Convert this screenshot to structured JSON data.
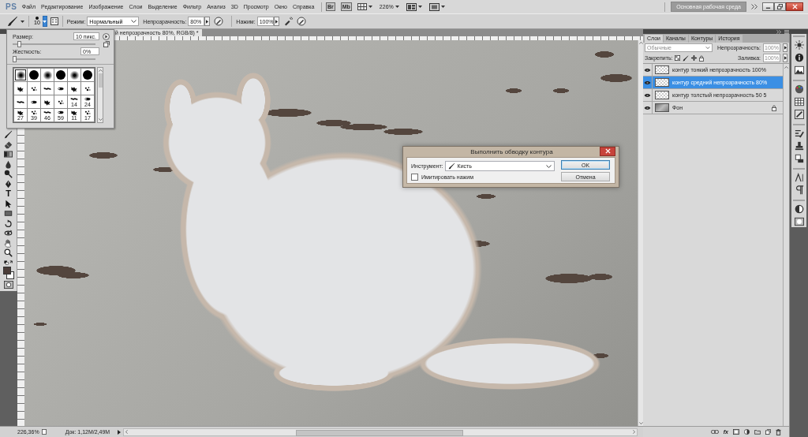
{
  "app": {
    "logo": "PS",
    "menu": [
      "Файл",
      "Редактирование",
      "Изображение",
      "Слои",
      "Выделение",
      "Фильтр",
      "Анализ",
      "3D",
      "Просмотр",
      "Окно",
      "Справка"
    ],
    "launchers": [
      "Br",
      "Mb"
    ],
    "zoom": "226%",
    "workspace": "Основная рабочая среда"
  },
  "options_bar": {
    "brush_size": "10",
    "mode_label": "Режим:",
    "mode": "Нормальный",
    "opacity_label": "Непрозрачность:",
    "opacity": "80%",
    "pressure_label": "Нажим:",
    "pressure": "100%"
  },
  "document": {
    "tab": "й непрозрачность 80%, RGB/8) *"
  },
  "toolbar": {
    "tools": [
      {
        "kind": "brush"
      },
      {
        "kind": "eraser"
      },
      {
        "kind": "gradient"
      },
      {
        "kind": "blur"
      },
      {
        "kind": "dodge"
      },
      {
        "kind": "pen"
      },
      {
        "kind": "type",
        "glyph": "T"
      },
      {
        "kind": "path-select"
      },
      {
        "kind": "shape"
      },
      {
        "kind": "rotate-3d"
      },
      {
        "kind": "orbit-3d"
      },
      {
        "kind": "hand"
      },
      {
        "kind": "zoom"
      }
    ],
    "colors": [
      {
        "kind": "background",
        "color": "#ffffff"
      },
      {
        "kind": "foreground",
        "color": "#4b3d39"
      }
    ]
  },
  "brush_panel": {
    "size_label": "Размер:",
    "size": "10 пикс.",
    "size_slider": {
      "level": 0.06
    },
    "hardness_label": "Жесткость:",
    "hardness": "0%",
    "hardness_slider": {
      "level": 0
    },
    "brushes": [
      {
        "kind": "soft",
        "selected": true
      },
      {
        "kind": "hard",
        "selected": false
      },
      {
        "kind": "soft",
        "selected": false
      },
      {
        "kind": "hard",
        "selected": false
      },
      {
        "kind": "soft",
        "selected": false
      },
      {
        "kind": "hard",
        "selected": false
      },
      {
        "kind": "special",
        "selected": false
      },
      {
        "kind": "special",
        "selected": false
      },
      {
        "kind": "special",
        "selected": false
      },
      {
        "kind": "special",
        "selected": false
      },
      {
        "kind": "special",
        "selected": false
      },
      {
        "kind": "special",
        "selected": false
      },
      {
        "kind": "special",
        "selected": false
      },
      {
        "kind": "special",
        "selected": false
      },
      {
        "kind": "special",
        "selected": false
      },
      {
        "kind": "special",
        "selected": false
      },
      {
        "kind": "special",
        "size": "14",
        "selected": false
      },
      {
        "kind": "special",
        "size": "24",
        "selected": false
      },
      {
        "kind": "special",
        "size": "27",
        "selected": false
      },
      {
        "kind": "special",
        "size": "39",
        "selected": false
      },
      {
        "kind": "special",
        "size": "46",
        "selected": false
      },
      {
        "kind": "special",
        "size": "59",
        "selected": false
      },
      {
        "kind": "special",
        "size": "11",
        "selected": false
      },
      {
        "kind": "special",
        "size": "17",
        "selected": false
      }
    ]
  },
  "dialog": {
    "title": "Выполнить обводку контура",
    "tool_label": "Инструмент:",
    "tool": "Кисть",
    "simulate_pressure": {
      "label": "Имитировать нажим",
      "checked": false
    },
    "buttons": [
      {
        "label": "OK",
        "default": true
      },
      {
        "label": "Отмена",
        "default": false
      }
    ]
  },
  "layers_panel": {
    "tabs": [
      {
        "label": "Слои",
        "selected": true
      },
      {
        "label": "Каналы",
        "selected": false
      },
      {
        "label": "Контуры",
        "selected": false
      },
      {
        "label": "История",
        "selected": false
      }
    ],
    "blend_mode": {
      "value": "Обычные",
      "disabled": true
    },
    "opacity_label": "Непрозрачность:",
    "opacity": {
      "value": "100%",
      "disabled": true
    },
    "lock_label": "Закрепить:",
    "fill_label": "Заливка:",
    "fill": {
      "value": "100%",
      "disabled": true
    },
    "layers": [
      {
        "name": "контур тонкий непрозрачность 100%",
        "kind": "transparent",
        "visible": true,
        "locked": false,
        "selected": false
      },
      {
        "name": "контур средний непрозрачность 80%",
        "kind": "transparent",
        "visible": true,
        "locked": false,
        "selected": true
      },
      {
        "name": "контур толстый непрозрачность 50 5",
        "kind": "transparent",
        "visible": true,
        "locked": false,
        "selected": false
      },
      {
        "name": "Фон",
        "kind": "photo",
        "visible": true,
        "locked": true,
        "selected": false
      }
    ],
    "fx_button": "fx"
  },
  "status_bar": {
    "zoom": "226,36%",
    "doc_size": "Док: 1,12М/2,49М"
  }
}
